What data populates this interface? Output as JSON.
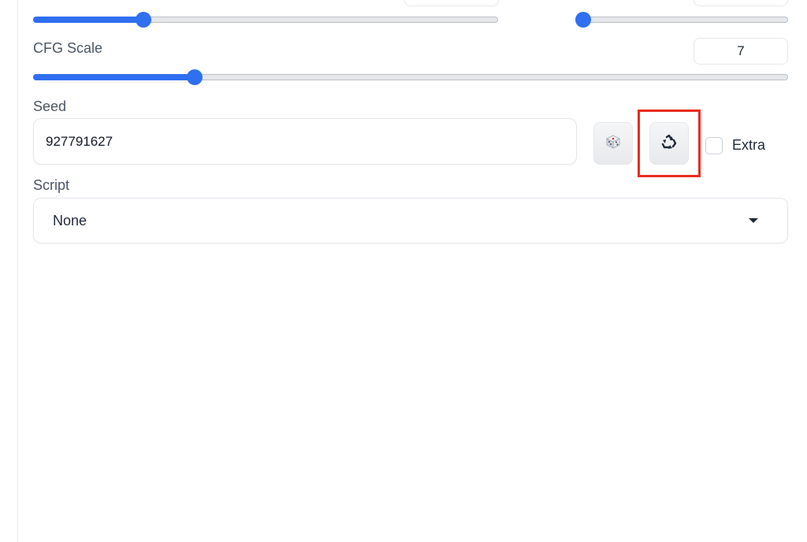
{
  "sliders": {
    "top_left": {
      "fraction": 0.237
    },
    "top_right": {
      "fraction": 0.035
    },
    "cfg_scale": {
      "fraction": 0.214
    }
  },
  "cfg_scale": {
    "label": "CFG Scale",
    "value": "7"
  },
  "seed": {
    "label": "Seed",
    "value": "927791627",
    "random_icon": "dice-icon",
    "reuse_icon": "recycle-icon",
    "extra_label": "Extra",
    "extra_checked": false
  },
  "script": {
    "label": "Script",
    "selected": "None"
  },
  "colors": {
    "accent": "#2f6ff0",
    "highlight": "#ea2b1f"
  }
}
